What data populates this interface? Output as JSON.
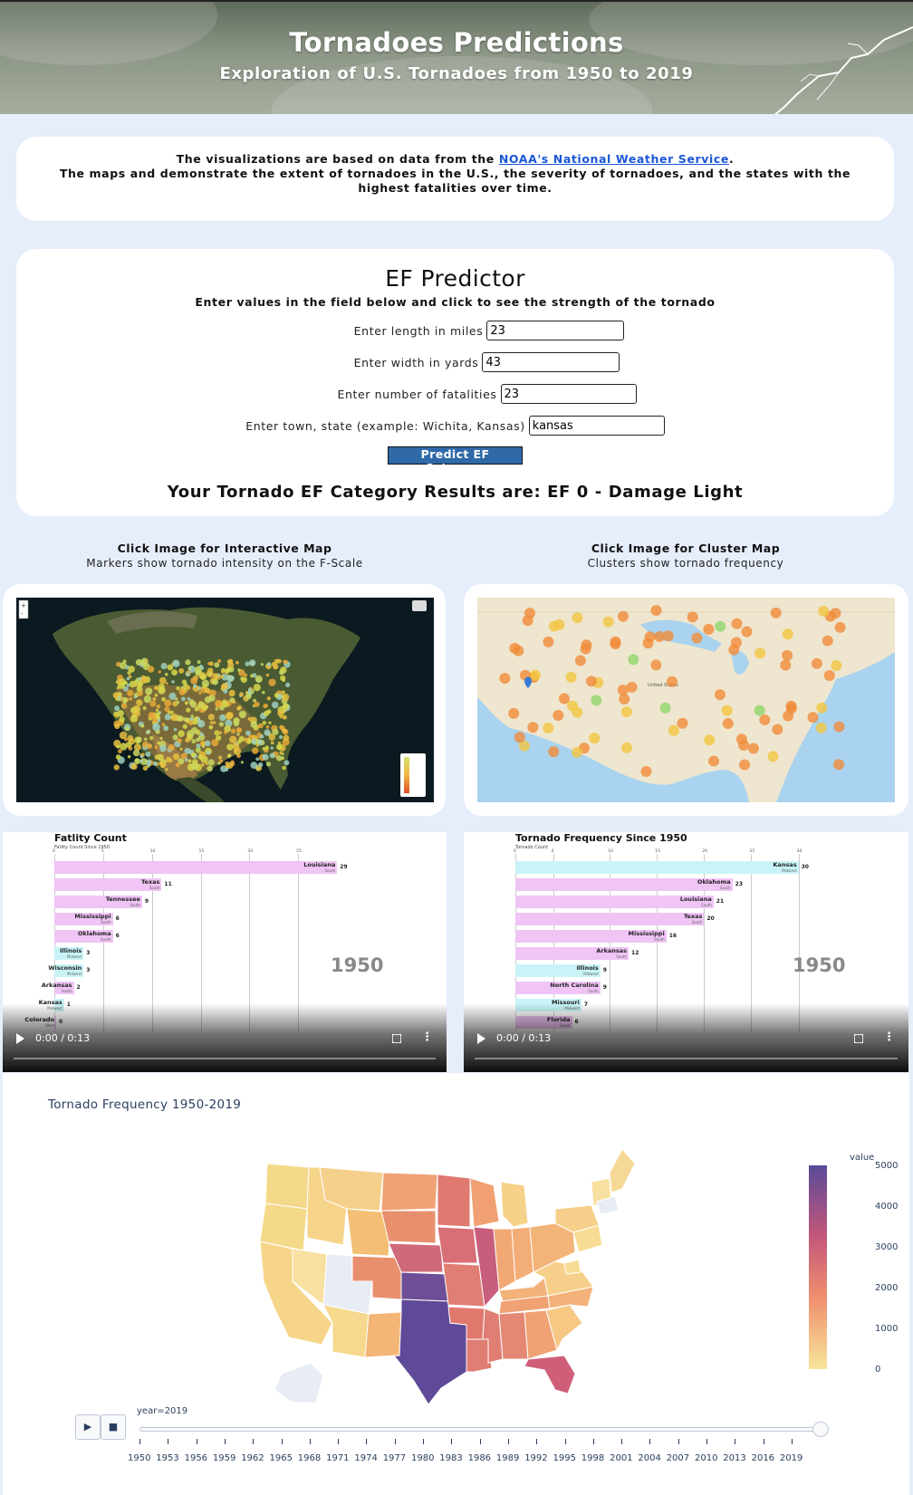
{
  "header": {
    "title": "Tornadoes Predictions",
    "subtitle": "Exploration of U.S. Tornadoes from 1950 to 2019"
  },
  "intro": {
    "line1_prefix": "The visualizations are based on data from the ",
    "link_text": "NOAA's National Weather Service",
    "line1_suffix": ".",
    "line2": "The maps and demonstrate the extent of tornadoes in the U.S., the severity of tornadoes, and the states with the highest fatalities over time."
  },
  "predictor": {
    "title": "EF Predictor",
    "subtitle": "Enter values in the field below and click to see the strength of the tornado",
    "fields": [
      {
        "label": "Enter length in miles",
        "value": "23"
      },
      {
        "label": "Enter width in yards",
        "value": "43"
      },
      {
        "label": "Enter number of fatalities",
        "value": "23"
      },
      {
        "label": "Enter town, state (example: Wichita, Kansas)",
        "value": "kansas"
      }
    ],
    "button_label": "Predict EF Category",
    "result_text": "Your Tornado EF Category Results are: EF 0 - Damage Light"
  },
  "maps": {
    "interactive": {
      "caption": "Click Image for Interactive Map",
      "subcaption": "Markers show tornado intensity on the F-Scale"
    },
    "cluster": {
      "caption": "Click Image for Cluster Map",
      "subcaption": "Clusters show tornado frequency",
      "map_label": "United States"
    }
  },
  "videos": [
    {
      "title": "Fatlity Count",
      "subtitle": "Fatlity Count Since 1950",
      "year": "1950",
      "time": "0:00 / 0:13",
      "ticks": [
        "0",
        "5",
        "10",
        "15",
        "20",
        "25"
      ],
      "bars": [
        {
          "label": "Louisiana",
          "region": "South",
          "value": "29"
        },
        {
          "label": "Texas",
          "region": "South",
          "value": "11"
        },
        {
          "label": "Tennessee",
          "region": "South",
          "value": "9"
        },
        {
          "label": "Mississippi",
          "region": "South",
          "value": "6"
        },
        {
          "label": "Oklahoma",
          "region": "South",
          "value": "6"
        },
        {
          "label": "Illinois",
          "region": "Midwest",
          "value": "3"
        },
        {
          "label": "Wisconsin",
          "region": "Midwest",
          "value": "3"
        },
        {
          "label": "Arkansas",
          "region": "South",
          "value": "2"
        },
        {
          "label": "Kansas",
          "region": "Midwest",
          "value": "1"
        },
        {
          "label": "Colorado",
          "region": "West",
          "value": "0"
        }
      ]
    },
    {
      "title": "Tornado Frequency Since 1950",
      "subtitle": "Tornado Count",
      "year": "1950",
      "time": "0:00 / 0:13",
      "ticks": [
        "0",
        "4",
        "10",
        "15",
        "20",
        "25",
        "30"
      ],
      "bars": [
        {
          "label": "Kansas",
          "region": "Midwest",
          "value": "30"
        },
        {
          "label": "Oklahoma",
          "region": "South",
          "value": "23"
        },
        {
          "label": "Louisiana",
          "region": "South",
          "value": "21"
        },
        {
          "label": "Texas",
          "region": "South",
          "value": "20"
        },
        {
          "label": "Mississippi",
          "region": "South",
          "value": "16"
        },
        {
          "label": "Arkansas",
          "region": "South",
          "value": "12"
        },
        {
          "label": "Illinois",
          "region": "Midwest",
          "value": "9"
        },
        {
          "label": "North Carolina",
          "region": "South",
          "value": "9"
        },
        {
          "label": "Missouri",
          "region": "Midwest",
          "value": "7"
        },
        {
          "label": "Florida",
          "region": "South",
          "value": "6"
        }
      ]
    }
  ],
  "choropleth": {
    "title": "Tornado Frequency 1950-2019",
    "colorbar_title": "value",
    "colorbar_ticks": [
      "5000",
      "4000",
      "3000",
      "2000",
      "1000",
      "0"
    ],
    "slider_label": "year=2019",
    "years": [
      "1950",
      "1953",
      "1956",
      "1959",
      "1962",
      "1965",
      "1968",
      "1971",
      "1974",
      "1977",
      "1980",
      "1983",
      "1986",
      "1989",
      "1992",
      "1995",
      "1998",
      "2001",
      "2004",
      "2007",
      "2010",
      "2013",
      "2016",
      "2019"
    ]
  },
  "colors": {
    "background": "#e6eefc",
    "link": "#1a56d6",
    "button": "#2f69a8",
    "bar_south": "#f0c4f5",
    "bar_midwest": "#c8f4f8"
  }
}
